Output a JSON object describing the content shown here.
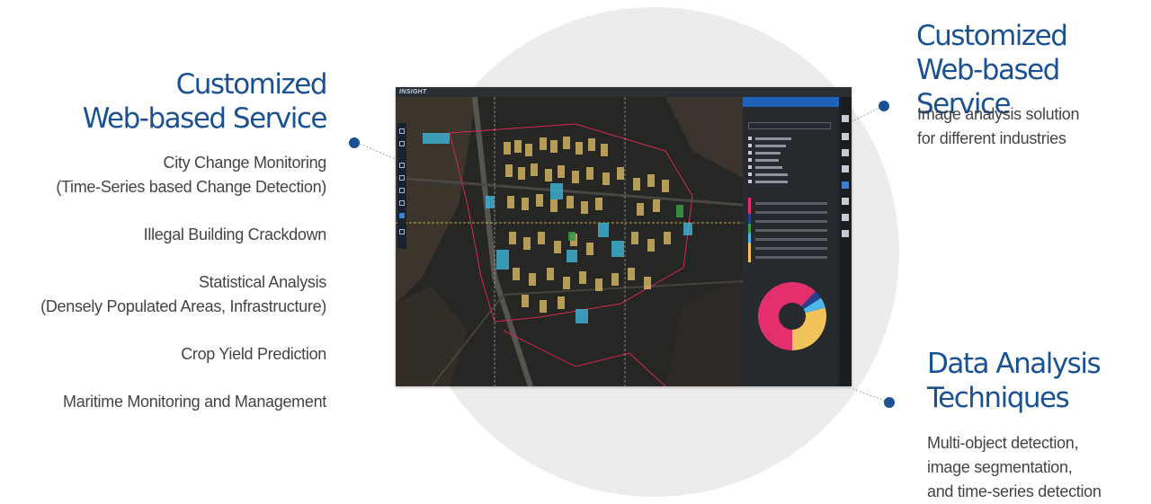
{
  "left_section": {
    "heading_line1": "Customized",
    "heading_line2": "Web-based Service",
    "items": [
      {
        "line1": "City Change Monitoring",
        "line2": "(Time-Series based Change Detection)"
      },
      {
        "line1": "Illegal Building Crackdown",
        "line2": ""
      },
      {
        "line1": "Statistical Analysis",
        "line2": "(Densely Populated Areas, Infrastructure)"
      },
      {
        "line1": "Crop Yield Prediction",
        "line2": ""
      },
      {
        "line1": "Maritime Monitoring and Management",
        "line2": ""
      }
    ]
  },
  "right_section": {
    "heading_line1": "Customized",
    "heading_line2": "Web-based Service",
    "desc_line1": "Image analysis solution",
    "desc_line2": "for different industries"
  },
  "data_section": {
    "heading_line1": "Data Analysis",
    "heading_line2": "Techniques",
    "desc_line1": "Multi-object detection,",
    "desc_line2": "image segmentation,",
    "desc_line3": "and time-series detection"
  },
  "screenshot": {
    "logo": "INSIGHT",
    "donut_fractions": [
      0.62,
      0.04,
      0.05,
      0.29
    ],
    "colors": {
      "accent": "#1a5192",
      "building": "#e7c46b",
      "detected": "#3fb6d9",
      "donut_pink": "#e3306d",
      "donut_navy": "#24408f",
      "donut_sky": "#4db7e8",
      "donut_yellow": "#f2c35b"
    }
  }
}
